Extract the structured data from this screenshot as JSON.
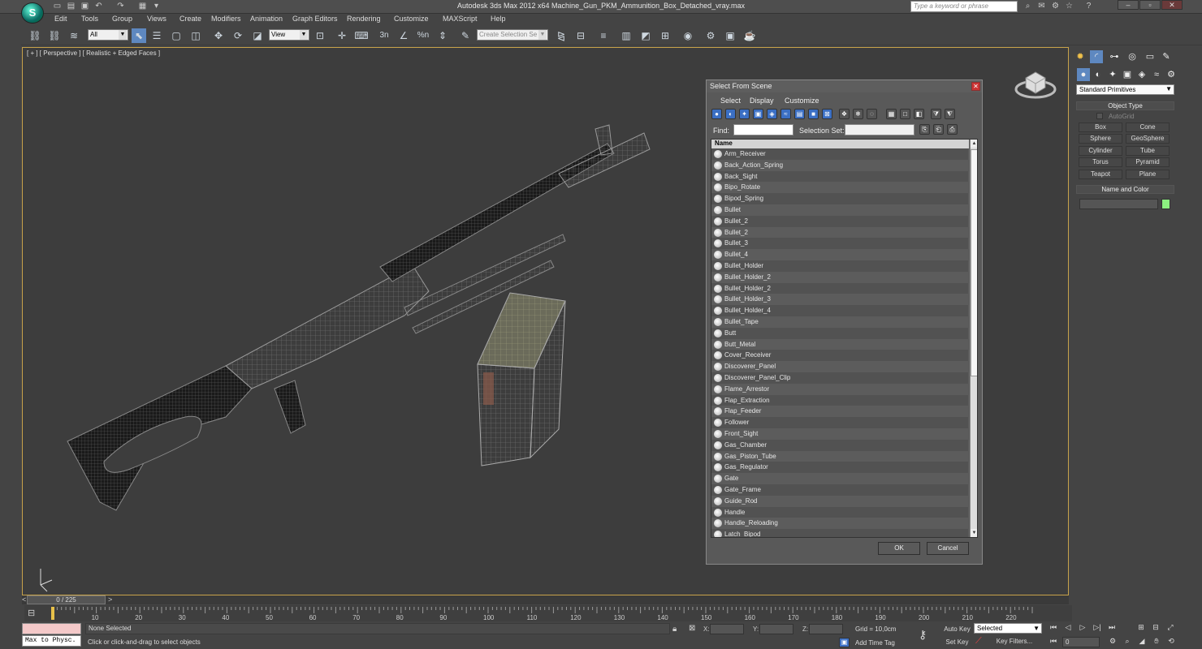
{
  "app": {
    "window_title": "Autodesk 3ds Max  2012 x64      Machine_Gun_PKM_Ammunition_Box_Detached_vray.max",
    "search_placeholder": "Type a keyword or phrase"
  },
  "menubar": [
    "Edit",
    "Tools",
    "Group",
    "Views",
    "Create",
    "Modifiers",
    "Animation",
    "Graph Editors",
    "Rendering",
    "Customize",
    "MAXScript",
    "Help"
  ],
  "toolbar": {
    "filter_value": "All",
    "coord_value": "View",
    "selection_set_placeholder": "Create Selection Se",
    "snap_labels": [
      "3n",
      "%n"
    ]
  },
  "viewport": {
    "label": "[ + ] [ Perspective ] [ Realistic + Edged Faces ]"
  },
  "dialog": {
    "title": "Select From Scene",
    "menu": [
      "Select",
      "Display",
      "Customize"
    ],
    "find_label": "Find:",
    "selection_set_label": "Selection Set:",
    "column_name": "Name",
    "items": [
      "Arm_Receiver",
      "Back_Action_Spring",
      "Back_Sight",
      "Bipo_Rotate",
      "Bipod_Spring",
      "Bullet",
      "Bullet_2",
      "Bullet_2",
      "Bullet_3",
      "Bullet_4",
      "Bullet_Holder",
      "Bullet_Holder_2",
      "Bullet_Holder_2",
      "Bullet_Holder_3",
      "Bullet_Holder_4",
      "Bullet_Tape",
      "Butt",
      "Butt_Metal",
      "Cover_Receiver",
      "Discoverer_Panel",
      "Discoverer_Panel_Clip",
      "Flame_Arrestor",
      "Flap_Extraction",
      "Flap_Feeder",
      "Follower",
      "Front_Sight",
      "Gas_Chamber",
      "Gas_Piston_Tube",
      "Gas_Regulator",
      "Gate",
      "Gate_Frame",
      "Guide_Rod",
      "Handle",
      "Handle_Reloading",
      "Latch_Bipod"
    ],
    "ok": "OK",
    "cancel": "Cancel"
  },
  "command_panel": {
    "dropdown": "Standard Primitives",
    "object_type_header": "Object Type",
    "autogrid": "AutoGrid",
    "primitives": [
      "Box",
      "Cone",
      "Sphere",
      "GeoSphere",
      "Cylinder",
      "Tube",
      "Torus",
      "Pyramid",
      "Teapot",
      "Plane"
    ],
    "name_color_header": "Name and Color",
    "color": "#8cf080"
  },
  "timeline": {
    "frame_display": "0 / 225",
    "ticks": [
      "10",
      "20",
      "30",
      "40",
      "50",
      "60",
      "70",
      "80",
      "90",
      "100",
      "110",
      "120",
      "130",
      "140",
      "150",
      "160",
      "170",
      "180",
      "190",
      "200",
      "210",
      "220"
    ]
  },
  "status": {
    "maxscript_mini": "Max to Physc.",
    "selection": "None Selected",
    "prompt": "Click or click-and-drag to select objects",
    "x_label": "X:",
    "y_label": "Y:",
    "z_label": "Z:",
    "grid": "Grid = 10,0cm",
    "add_time_tag": "Add Time Tag",
    "auto_key": "Auto Key",
    "set_key": "Set Key",
    "selected_value": "Selected",
    "key_filters": "Key Filters...",
    "current_frame": "0"
  }
}
